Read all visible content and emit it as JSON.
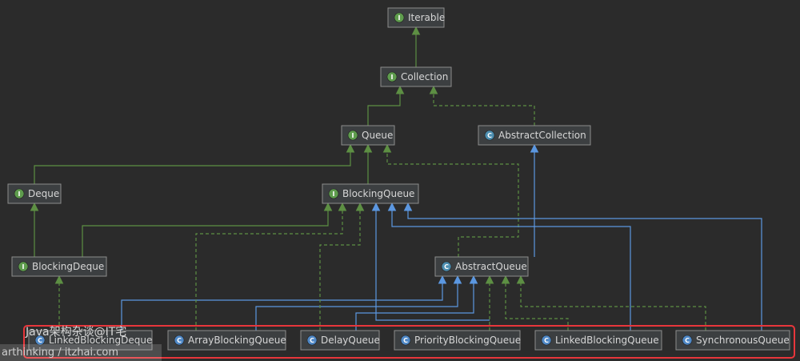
{
  "colors": {
    "interface_badge": "#5e9c4d",
    "abstract_badge": "#4d8eb0",
    "class_badge": "#4f88c6",
    "extends_interface": "#5d8f43",
    "implements": "#5d8f43",
    "extends_class": "#5b97e0",
    "highlight": "#e8363b"
  },
  "nodes": [
    {
      "id": "iterable",
      "label": "Iterable",
      "kind": "interface",
      "badge": "I"
    },
    {
      "id": "collection",
      "label": "Collection",
      "kind": "interface",
      "badge": "I"
    },
    {
      "id": "queue",
      "label": "Queue",
      "kind": "interface",
      "badge": "I"
    },
    {
      "id": "abstractcollection",
      "label": "AbstractCollection",
      "kind": "abstract",
      "badge": "C"
    },
    {
      "id": "deque",
      "label": "Deque",
      "kind": "interface",
      "badge": "I"
    },
    {
      "id": "blockingqueue",
      "label": "BlockingQueue",
      "kind": "interface",
      "badge": "I"
    },
    {
      "id": "blockingdeque",
      "label": "BlockingDeque",
      "kind": "interface",
      "badge": "I"
    },
    {
      "id": "abstractqueue",
      "label": "AbstractQueue",
      "kind": "abstract",
      "badge": "C"
    },
    {
      "id": "linkedblockingdeque",
      "label": "LinkedBlockingDeque",
      "kind": "class",
      "badge": "C"
    },
    {
      "id": "arrayblockingqueue",
      "label": "ArrayBlockingQueue",
      "kind": "class",
      "badge": "C"
    },
    {
      "id": "delayqueue",
      "label": "DelayQueue",
      "kind": "class",
      "badge": "C"
    },
    {
      "id": "priorityblockingqueue",
      "label": "PriorityBlockingQueue",
      "kind": "class",
      "badge": "C"
    },
    {
      "id": "linkedblockingqueue",
      "label": "LinkedBlockingQueue",
      "kind": "class",
      "badge": "C"
    },
    {
      "id": "synchronousqueue",
      "label": "SynchronousQueue",
      "kind": "class",
      "badge": "C"
    }
  ],
  "edges": [
    {
      "from": "collection",
      "to": "iterable",
      "type": "extends_interface"
    },
    {
      "from": "queue",
      "to": "collection",
      "type": "extends_interface"
    },
    {
      "from": "abstractcollection",
      "to": "collection",
      "type": "implements"
    },
    {
      "from": "deque",
      "to": "queue",
      "type": "extends_interface"
    },
    {
      "from": "blockingqueue",
      "to": "queue",
      "type": "extends_interface"
    },
    {
      "from": "blockingdeque",
      "to": "deque",
      "type": "extends_interface"
    },
    {
      "from": "blockingdeque",
      "to": "blockingqueue",
      "type": "extends_interface"
    },
    {
      "from": "abstractqueue",
      "to": "abstractcollection",
      "type": "extends_class"
    },
    {
      "from": "abstractqueue",
      "to": "queue",
      "type": "implements"
    },
    {
      "from": "linkedblockingdeque",
      "to": "blockingdeque",
      "type": "implements"
    },
    {
      "from": "linkedblockingdeque",
      "to": "abstractqueue",
      "type": "extends_class"
    },
    {
      "from": "arrayblockingqueue",
      "to": "blockingqueue",
      "type": "implements"
    },
    {
      "from": "arrayblockingqueue",
      "to": "abstractqueue",
      "type": "extends_class"
    },
    {
      "from": "delayqueue",
      "to": "blockingqueue",
      "type": "implements"
    },
    {
      "from": "delayqueue",
      "to": "abstractqueue",
      "type": "extends_class"
    },
    {
      "from": "priorityblockingqueue",
      "to": "blockingqueue",
      "type": "implements"
    },
    {
      "from": "priorityblockingqueue",
      "to": "abstractqueue",
      "type": "extends_class"
    },
    {
      "from": "linkedblockingqueue",
      "to": "blockingqueue",
      "type": "implements"
    },
    {
      "from": "linkedblockingqueue",
      "to": "abstractqueue",
      "type": "extends_class"
    },
    {
      "from": "synchronousqueue",
      "to": "blockingqueue",
      "type": "implements"
    },
    {
      "from": "synchronousqueue",
      "to": "abstractqueue",
      "type": "extends_class"
    }
  ],
  "watermark": {
    "line1": "Java架构杂谈@IT宅",
    "line2": "arthinking / itzhai.com"
  }
}
